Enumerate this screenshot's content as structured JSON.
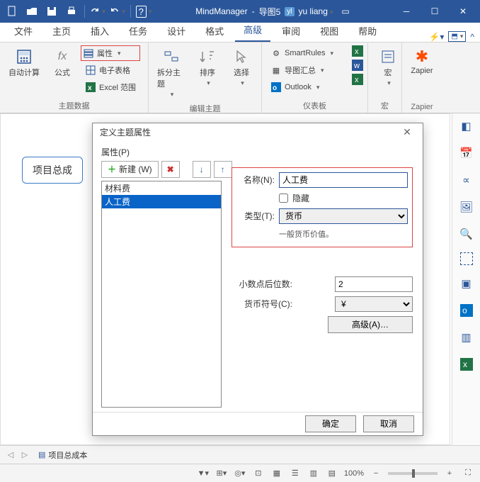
{
  "titlebar": {
    "app": "MindManager",
    "doc": "导图5",
    "user_initials": "yl",
    "user_name": "yu liang"
  },
  "tabs": [
    "文件",
    "主页",
    "插入",
    "任务",
    "设计",
    "格式",
    "高级",
    "审阅",
    "视图",
    "帮助"
  ],
  "tabs_active_index": 6,
  "ribbon": {
    "group1": {
      "title": "主题数据",
      "autocalc": "自动计算",
      "formula": "公式",
      "properties": "属性",
      "spreadsheet": "电子表格",
      "excelrange": "Excel 范围"
    },
    "group2": {
      "title": "编辑主题",
      "split": "拆分主题",
      "sort": "排序",
      "select": "选择"
    },
    "group3": {
      "title": "仪表板",
      "smartrules": "SmartRules",
      "mapsummary": "导图汇总",
      "outlook": "Outlook"
    },
    "group4": {
      "title": "宏",
      "macro": "宏"
    },
    "group5": {
      "title": "Zapier",
      "zapier": "Zapier"
    }
  },
  "canvas": {
    "topic": "项目总成"
  },
  "bottom": {
    "tab": "项目总成本"
  },
  "status": {
    "zoom": "100%"
  },
  "dialog": {
    "title": "定义主题属性",
    "props_label": "属性(P)",
    "new_btn": "新建 (W)",
    "list": [
      "材料费",
      "人工费"
    ],
    "selected_index": 1,
    "name_label": "名称(N):",
    "name_value": "人工费",
    "hidden_label": "隐藏",
    "type_label": "类型(T):",
    "type_value": "货币",
    "type_hint": "一般货币价值。",
    "decimals_label": "小数点后位数:",
    "decimals_value": "2",
    "currency_label": "货币符号(C):",
    "currency_value": "¥",
    "advanced_btn": "高级(A)…",
    "ok": "确定",
    "cancel": "取消"
  }
}
